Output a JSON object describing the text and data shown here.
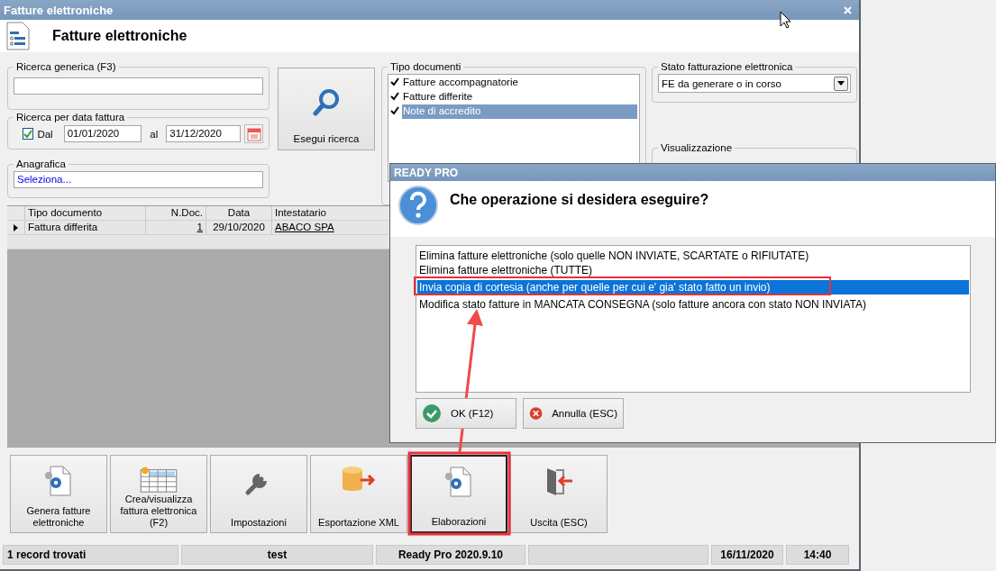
{
  "window": {
    "title": "Fatture elettroniche",
    "heading": "Fatture elettroniche"
  },
  "search_group": {
    "label": "Ricerca generica (F3)"
  },
  "date_group": {
    "label": "Ricerca per data fattura",
    "checkbox_label": "Dal",
    "checked": true,
    "from": "01/01/2020",
    "to_label": "al",
    "to": "31/12/2020"
  },
  "anagrafica": {
    "label": "Anagrafica",
    "value": "Seleziona..."
  },
  "search_button": "Esegui ricerca",
  "document_types": {
    "label": "Tipo documenti",
    "items": [
      {
        "label": "Fatture accompagnatorie",
        "checked": true,
        "selected": false
      },
      {
        "label": "Fatture differite",
        "checked": true,
        "selected": false
      },
      {
        "label": "Note di accredito",
        "checked": true,
        "selected": true
      }
    ]
  },
  "status_filter": {
    "label": "Stato fatturazione elettronica",
    "value": "FE da generare o in corso"
  },
  "view_group": {
    "label": "Visualizzazione"
  },
  "table": {
    "columns": [
      "Tipo documento",
      "N.Doc.",
      "Data",
      "Intestatario"
    ],
    "rows": [
      {
        "cells": [
          "Fattura differita",
          "1",
          "29/10/2020",
          "ABACO SPA"
        ],
        "current": true
      }
    ]
  },
  "actions": [
    {
      "label": "Genera fatture elettroniche",
      "kind": "generate",
      "focused": false
    },
    {
      "label": "Crea/visualizza fattura elettronica (F2)",
      "kind": "table",
      "focused": false
    },
    {
      "label": "Impostazioni",
      "kind": "settings",
      "focused": false
    },
    {
      "label": "Esportazione XML",
      "kind": "export",
      "focused": false
    },
    {
      "label": "Elaborazioni",
      "kind": "process",
      "focused": true
    },
    {
      "label": "Uscita (ESC)",
      "kind": "exit",
      "focused": false
    }
  ],
  "status_bar": [
    "1 record trovati",
    "test",
    "Ready Pro 2020.9.10",
    "16/11/2020",
    "14:40"
  ],
  "dialog": {
    "title": "READY PRO",
    "question": "Che operazione si desidera eseguire?",
    "options": [
      {
        "label": "Elimina fatture elettroniche (solo quelle NON INVIATE, SCARTATE o RIFIUTATE)",
        "selected": false
      },
      {
        "label": "Elimina fatture elettroniche (TUTTE)",
        "selected": false
      },
      {
        "label": "Invia copia di cortesia (anche per quelle per cui e' gia' stato fatto un invio)",
        "selected": true
      },
      {
        "label": "Modifica stato fatture in MANCATA CONSEGNA (solo fatture ancora con stato NON INVIATA)",
        "selected": false
      }
    ],
    "buttons": [
      {
        "label": "OK (F12)",
        "kind": "ok"
      },
      {
        "label": "Annulla (ESC)",
        "kind": "cancel"
      }
    ]
  }
}
